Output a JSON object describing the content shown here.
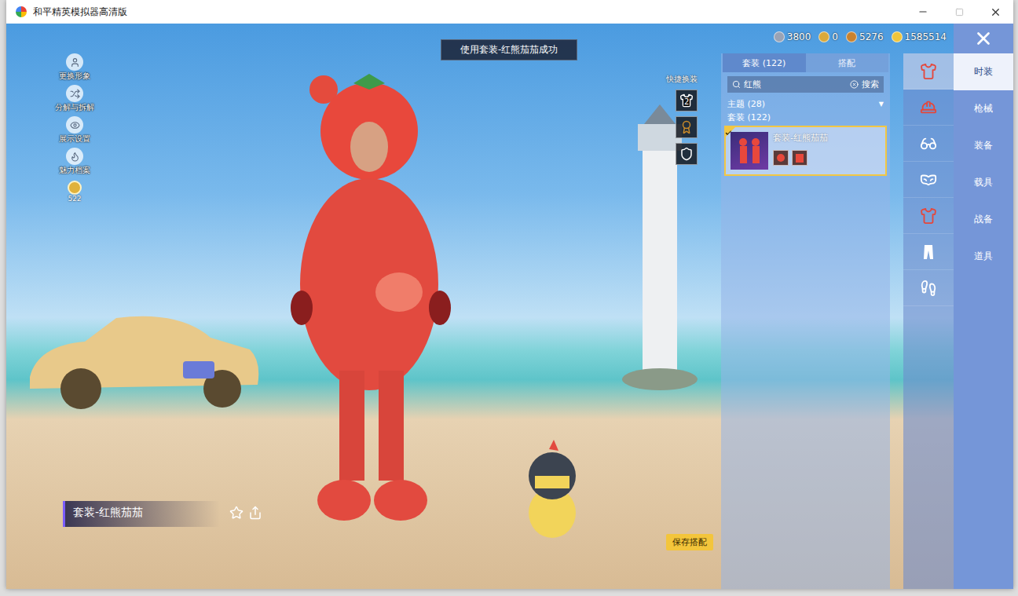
{
  "window": {
    "title": "和平精英模拟器高清版"
  },
  "toast": "使用套装-红熊茄茄成功",
  "currencies": [
    {
      "value": "3800",
      "color": "#9aa3b5"
    },
    {
      "value": "0",
      "color": "#d9a93a"
    },
    {
      "value": "5276",
      "color": "#c9822e"
    },
    {
      "value": "1585514",
      "color": "#f0c53c"
    }
  ],
  "side_menu": [
    {
      "label": "更换形象",
      "kind": "avatar"
    },
    {
      "label": "分解与拆解",
      "kind": "dismantle"
    },
    {
      "label": "展示设置",
      "kind": "display"
    },
    {
      "label": "魅力档案",
      "kind": "charm"
    }
  ],
  "level_badge": "522",
  "quick_change": {
    "label": "快捷换装",
    "slots": [
      {
        "kind": "hanger",
        "count": "2"
      },
      {
        "kind": "badge",
        "count": ""
      },
      {
        "kind": "emblem",
        "count": ""
      }
    ]
  },
  "outfit_name": "套装-红熊茄茄",
  "save_button": "保存搭配",
  "panel": {
    "tabs": [
      {
        "label": "套装 (122)",
        "selected": true
      },
      {
        "label": "搭配",
        "selected": false
      }
    ],
    "search": {
      "value": "红熊",
      "button": "搜索"
    },
    "filters": [
      {
        "label": "主题 (28)",
        "expandable": true,
        "marker": "▼"
      },
      {
        "label": "套装 (122)",
        "expandable": false,
        "marker": ""
      }
    ],
    "items": [
      {
        "name": "套装-红熊茄茄",
        "selected": true
      }
    ]
  },
  "icon_tabs": [
    {
      "kind": "suit",
      "selected": true
    },
    {
      "kind": "helmet",
      "selected": false
    },
    {
      "kind": "glasses",
      "selected": false
    },
    {
      "kind": "mask",
      "selected": false
    },
    {
      "kind": "top",
      "selected": false
    },
    {
      "kind": "pants",
      "selected": false
    },
    {
      "kind": "shoes",
      "selected": false
    }
  ],
  "categories": [
    {
      "label": "时装",
      "selected": true
    },
    {
      "label": "枪械",
      "selected": false
    },
    {
      "label": "装备",
      "selected": false
    },
    {
      "label": "载具",
      "selected": false
    },
    {
      "label": "战备",
      "selected": false
    },
    {
      "label": "道具",
      "selected": false
    }
  ]
}
